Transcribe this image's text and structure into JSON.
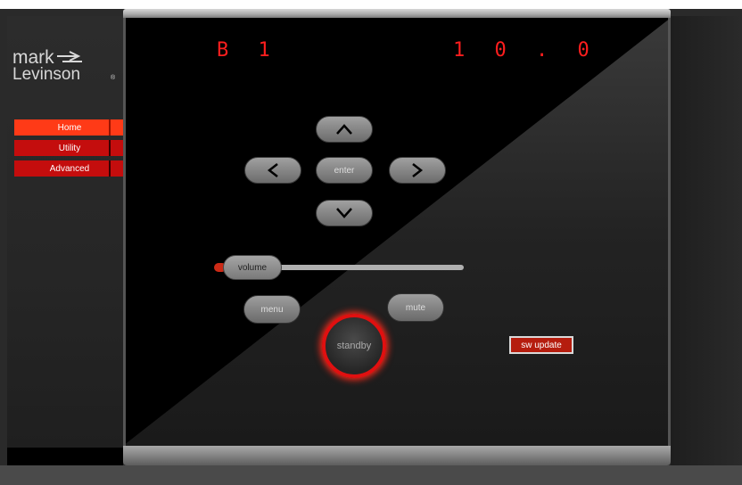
{
  "brand": {
    "logo_line1": "mark",
    "logo_line2": "Levinson",
    "logo_mark": "®"
  },
  "sidebar": {
    "items": [
      {
        "label": "Home",
        "state": "active"
      },
      {
        "label": "Utility",
        "state": "normal"
      },
      {
        "label": "Advanced",
        "state": "normal"
      }
    ]
  },
  "display": {
    "input": "B 1",
    "volume_level": "1 0 . 0"
  },
  "controls": {
    "up_icon": "chevron-up-icon",
    "down_icon": "chevron-down-icon",
    "left_icon": "chevron-left-icon",
    "right_icon": "chevron-right-icon",
    "enter_label": "enter",
    "volume_label": "volume",
    "menu_label": "menu",
    "mute_label": "mute",
    "standby_label": "standby",
    "sw_update_label": "sw update"
  },
  "colors": {
    "accent_red": "#e01010",
    "readout_red": "#ff1e1e",
    "home_active": "#ff3a17",
    "menu_normal": "#c40d0d"
  }
}
